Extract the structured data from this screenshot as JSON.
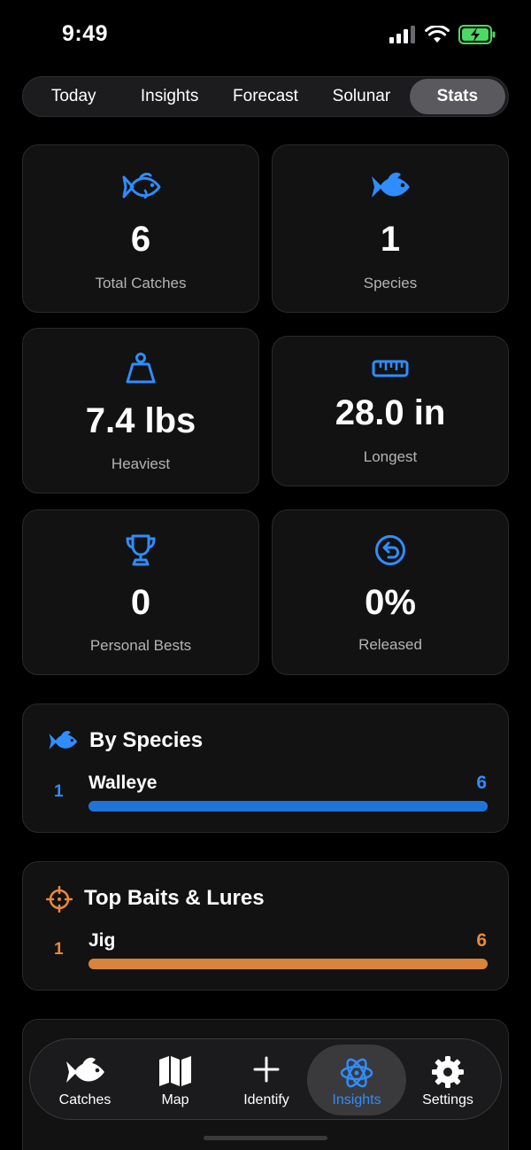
{
  "status": {
    "time": "9:49"
  },
  "tabs": [
    {
      "label": "Today",
      "active": false
    },
    {
      "label": "Insights",
      "active": false
    },
    {
      "label": "Forecast",
      "active": false
    },
    {
      "label": "Solunar",
      "active": false
    },
    {
      "label": "Stats",
      "active": true
    }
  ],
  "stats": {
    "total_catches": {
      "value": "6",
      "label": "Total Catches",
      "icon": "fish-outline-icon"
    },
    "species": {
      "value": "1",
      "label": "Species",
      "icon": "fish-filled-icon"
    },
    "heaviest": {
      "value": "7.4 lbs",
      "label": "Heaviest",
      "icon": "weight-icon"
    },
    "longest": {
      "value": "28.0 in",
      "label": "Longest",
      "icon": "ruler-icon"
    },
    "personal_bests": {
      "value": "0",
      "label": "Personal Bests",
      "icon": "trophy-icon"
    },
    "released": {
      "value": "0%",
      "label": "Released",
      "icon": "release-arrow-icon"
    }
  },
  "by_species": {
    "title": "By Species",
    "icon": "fish-filled-icon",
    "rows": [
      {
        "rank": "1",
        "name": "Walleye",
        "count": "6",
        "fraction": 1.0
      }
    ],
    "color": "#1f74d8"
  },
  "top_baits": {
    "title": "Top Baits & Lures",
    "icon": "crosshair-icon",
    "rows": [
      {
        "rank": "1",
        "name": "Jig",
        "count": "6",
        "fraction": 1.0
      }
    ],
    "color": "#e8893a"
  },
  "bottom_nav": [
    {
      "label": "Catches",
      "icon": "fish-icon",
      "active": false
    },
    {
      "label": "Map",
      "icon": "map-icon",
      "active": false
    },
    {
      "label": "Identify",
      "icon": "plus-icon",
      "active": false
    },
    {
      "label": "Insights",
      "icon": "atom-icon",
      "active": true
    },
    {
      "label": "Settings",
      "icon": "gear-icon",
      "active": false
    }
  ],
  "colors": {
    "accent_blue": "#2f8dff",
    "accent_orange": "#e8893a",
    "card_bg": "#121212"
  }
}
